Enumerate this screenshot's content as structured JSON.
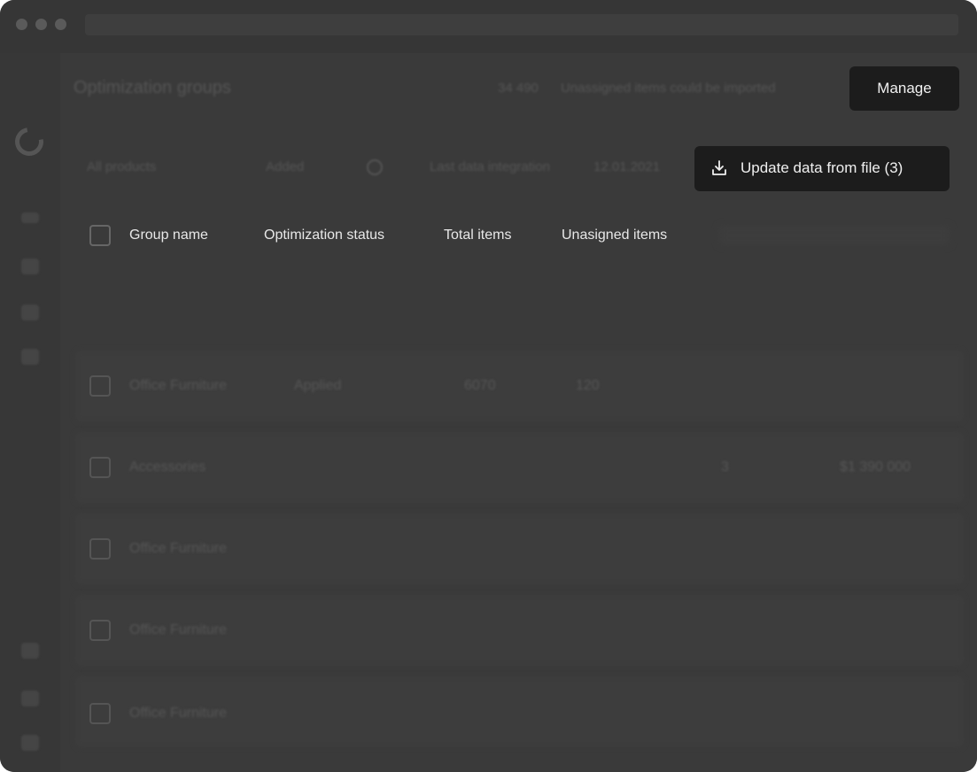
{
  "header": {
    "title": "Optimization groups",
    "notice_count": "34 490",
    "notice_text": "Unassigned items could be imported",
    "manage_label": "Manage"
  },
  "toolbar": {
    "filter_value": "All products",
    "filter_value2": "Added",
    "last_integration_label": "Last data integration",
    "last_integration_date": "12.01.2021",
    "update_label": "Update data from file (3)"
  },
  "table": {
    "columns": [
      "Group name",
      "Optimization status",
      "Total items",
      "Unasigned items"
    ],
    "rows": [
      {
        "name": "Office Furniture",
        "status": "Applied",
        "total": "6070",
        "unassigned": "120",
        "extra": "",
        "amount": ""
      },
      {
        "name": "Accessories",
        "status": "",
        "total": "",
        "unassigned": "",
        "extra": "3",
        "amount": "$1 390 000"
      },
      {
        "name": "Office Furniture",
        "status": "",
        "total": "",
        "unassigned": "",
        "extra": "",
        "amount": ""
      },
      {
        "name": "Office Furniture",
        "status": "",
        "total": "",
        "unassigned": "",
        "extra": "",
        "amount": ""
      },
      {
        "name": "Office Furniture",
        "status": "",
        "total": "",
        "unassigned": "",
        "extra": "",
        "amount": ""
      }
    ]
  },
  "icons": {
    "logo": "logo-ring-icon",
    "download": "download-icon",
    "search": "search-icon"
  },
  "colors": {
    "background": "#3a3a3a",
    "button": "#1c1c1c",
    "button_text": "#f0f0f0"
  }
}
